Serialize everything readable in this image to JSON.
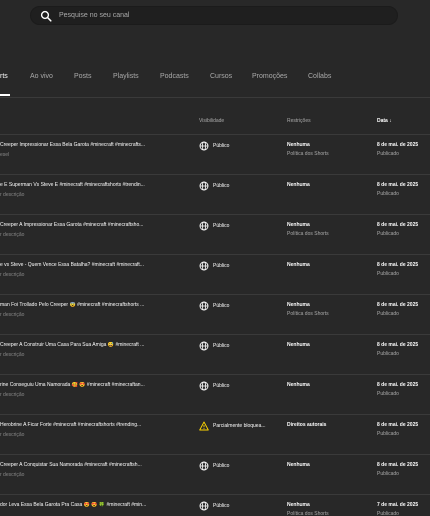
{
  "search": {
    "placeholder": "Pesquise no seu canal"
  },
  "tabs": [
    {
      "label": "rts",
      "active": true
    },
    {
      "label": "Ao vivo"
    },
    {
      "label": "Posts"
    },
    {
      "label": "Playlists"
    },
    {
      "label": "Podcasts"
    },
    {
      "label": "Cursos"
    },
    {
      "label": "Promoções"
    },
    {
      "label": "Collabs"
    }
  ],
  "table": {
    "headers": {
      "visibility": "Visibilidade",
      "restrictions": "Restrições",
      "date": "Data ↓"
    },
    "rows": [
      {
        "title": "Creeper Impressionar Essa Bela Garota #minecraft #minecrafts...",
        "sub": "esel",
        "visibility": "Público",
        "vis_icon": "globe-icon",
        "restriction": "Nenhuma",
        "restriction_sub": "Política dos Shorts",
        "date": "8 de mai. de 2025",
        "date_sub": "Publicado"
      },
      {
        "title": "e E Superman Vs Steve E #minecraft #minecraftshorts #trendin...",
        "sub": "r descrição",
        "visibility": "Público",
        "vis_icon": "globe-icon",
        "restriction": "Nenhuma",
        "restriction_sub": "",
        "date": "8 de mai. de 2025",
        "date_sub": "Publicado"
      },
      {
        "title": "Creeper A Impressionar Essa Garota #minecraft #minecraftsho...",
        "sub": "r descrição",
        "visibility": "Público",
        "vis_icon": "globe-icon",
        "restriction": "Nenhuma",
        "restriction_sub": "Política dos Shorts",
        "date": "8 de mai. de 2025",
        "date_sub": "Publicado"
      },
      {
        "title": "e vs Steve - Quem Vence Essa Batalha? #minecraft #minecraft...",
        "sub": "r descrição",
        "visibility": "Público",
        "vis_icon": "globe-icon",
        "restriction": "Nenhuma",
        "restriction_sub": "",
        "date": "8 de mai. de 2025",
        "date_sub": "Publicado"
      },
      {
        "title": "man Foi Trollado Pelo Creeper 😨 #minecraft #minecraftshorts ...",
        "sub": "r descrição",
        "visibility": "Público",
        "vis_icon": "globe-icon",
        "restriction": "Nenhuma",
        "restriction_sub": "Política dos Shorts",
        "date": "8 de mai. de 2025",
        "date_sub": "Publicado"
      },
      {
        "title": "Creeper A Construir Uma Casa Para Sua Amiga 😅 #minecraft ...",
        "sub": "r descrição",
        "visibility": "Público",
        "vis_icon": "globe-icon",
        "restriction": "Nenhuma",
        "restriction_sub": "",
        "date": "8 de mai. de 2025",
        "date_sub": "Publicado"
      },
      {
        "title": "rine Conseguiu Uma Namorada 🥰 😍 #minecraft #minecraftan...",
        "sub": "r descrição",
        "visibility": "Público",
        "vis_icon": "globe-icon",
        "restriction": "Nenhuma",
        "restriction_sub": "",
        "date": "8 de mai. de 2025",
        "date_sub": "Publicado"
      },
      {
        "title": "Herobrine A Ficar Forte #minecraft #minecraftshorts #trending...",
        "sub": "r descrição",
        "visibility": "Parcialmente bloquea...",
        "vis_icon": "warning-icon",
        "restriction": "Direitos autorais",
        "restriction_sub": "",
        "date": "8 de mai. de 2025",
        "date_sub": "Publicado"
      },
      {
        "title": "Creeper A Conquistar Sua Namorada #minecraft #minecraftsh...",
        "sub": "r descrição",
        "visibility": "Público",
        "vis_icon": "globe-icon",
        "restriction": "Nenhuma",
        "restriction_sub": "",
        "date": "8 de mai. de 2025",
        "date_sub": "Publicado"
      },
      {
        "title": "dor Leva Essa Bela Garota Pra Casa 😍 😍 🍀 #minecraft #min...",
        "sub": "",
        "visibility": "Público",
        "vis_icon": "globe-icon",
        "restriction": "Nenhuma",
        "restriction_sub": "Política dos Shorts",
        "date": "7 de mai. de 2025",
        "date_sub": "Publicado"
      }
    ]
  },
  "colors": {
    "background": "#282828",
    "search_bg": "#1f1f1f",
    "muted": "#aaaaaa",
    "warning": "#ffd600"
  }
}
